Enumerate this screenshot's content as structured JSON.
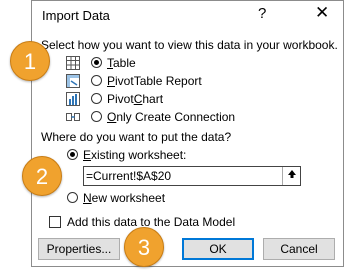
{
  "dialog": {
    "title": "Import Data",
    "help_glyph": "?",
    "close_glyph": "✕"
  },
  "view_section": {
    "prompt": "Select how you want to view this data in your workbook.",
    "options": [
      {
        "label": "Table",
        "selected": true,
        "icon": "table-icon"
      },
      {
        "label": "PivotTable Report",
        "selected": false,
        "icon": "pivottable-icon"
      },
      {
        "label": "PivotChart",
        "selected": false,
        "icon": "pivotchart-icon"
      },
      {
        "label": "Only Create Connection",
        "selected": false,
        "icon": "connection-icon"
      }
    ]
  },
  "location_section": {
    "prompt": "Where do you want to put the data?",
    "existing_label": "Existing worksheet:",
    "existing_selected": true,
    "cell_reference": "=Current!$A$20",
    "new_label": "New worksheet",
    "new_selected": false
  },
  "data_model": {
    "label": "Add this data to the Data Model",
    "checked": false
  },
  "buttons": {
    "properties": "Properties...",
    "ok": "OK",
    "cancel": "Cancel"
  },
  "callouts": [
    "1",
    "2",
    "3"
  ],
  "colors": {
    "callout_fill": "#f0a22e",
    "ok_focus_border": "#0078d7"
  }
}
